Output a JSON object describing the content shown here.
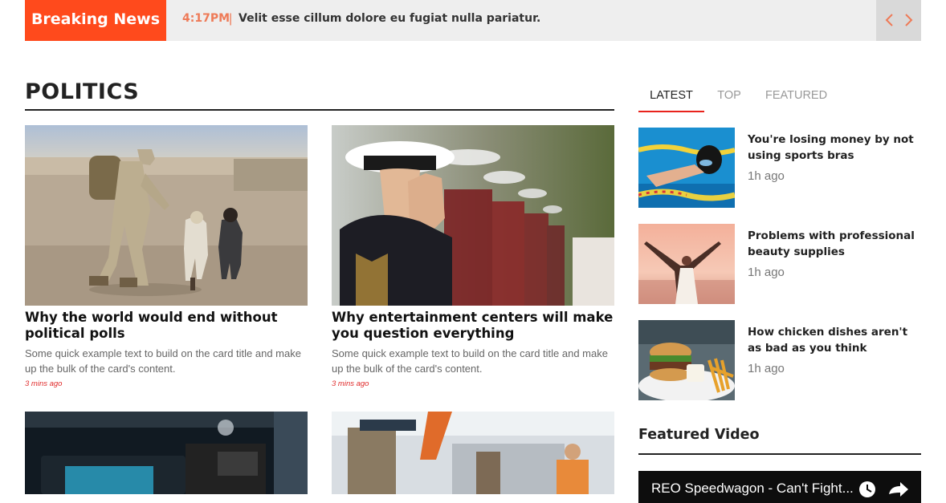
{
  "breaking": {
    "label": "Breaking News",
    "time": "4:17PM",
    "separator": "|",
    "headline": "Velit esse cillum dolore eu fugiat nulla pariatur."
  },
  "section": {
    "title": "POLITICS"
  },
  "cards": [
    {
      "title": "Why the world would end without political polls",
      "text": "Some quick example text to build on the card title and make up the bulk of the card's content.",
      "time": "3 mins ago"
    },
    {
      "title": "Why entertainment centers will make you question everything",
      "text": "Some quick example text to build on the card title and make up the bulk of the card's content.",
      "time": "3 mins ago"
    }
  ],
  "tabs": [
    "LATEST",
    "TOP",
    "FEATURED"
  ],
  "latest": [
    {
      "title": "You're losing money by not using sports bras",
      "time": "1h ago"
    },
    {
      "title": "Problems with professional beauty supplies",
      "time": "1h ago"
    },
    {
      "title": "How chicken dishes aren't as bad as you think",
      "time": "1h ago"
    }
  ],
  "featured_video": {
    "heading": "Featured Video",
    "title": "REO Speedwagon - Can't Fight..."
  },
  "colors": {
    "accent": "#ff4a1c",
    "time_red": "#e02b2b",
    "tab_underline": "#e8231c"
  }
}
